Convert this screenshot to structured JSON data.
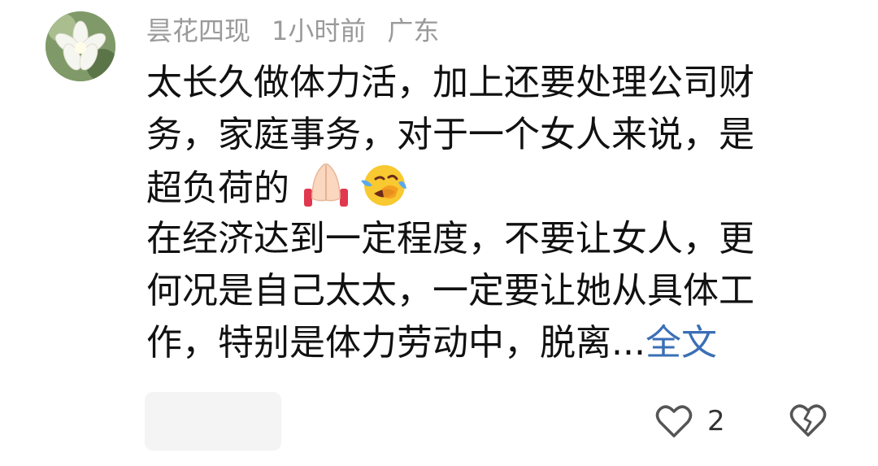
{
  "comment": {
    "author": "昙花四现",
    "time": "1小时前",
    "location": "广东",
    "lines": [
      "太长久做体力活，加上还要处理公司财",
      "务，家庭事务，对于一个女人来说，是",
      "超负荷的",
      "在经济达到一定程度，不要让女人，更",
      "何况是自己太太，一定要让她从具体工",
      "作，特别是体力劳动中，脱离..."
    ],
    "expand_label": "全文",
    "emojis": [
      "praying-hands-icon",
      "laughing-crying-face-icon"
    ],
    "like_count": "2"
  },
  "icons": {
    "like": "heart-outline-icon",
    "dislike": "broken-heart-icon"
  },
  "colors": {
    "meta_text": "#9a9a9a",
    "body_text": "#111111",
    "link": "#3b6fb6"
  }
}
